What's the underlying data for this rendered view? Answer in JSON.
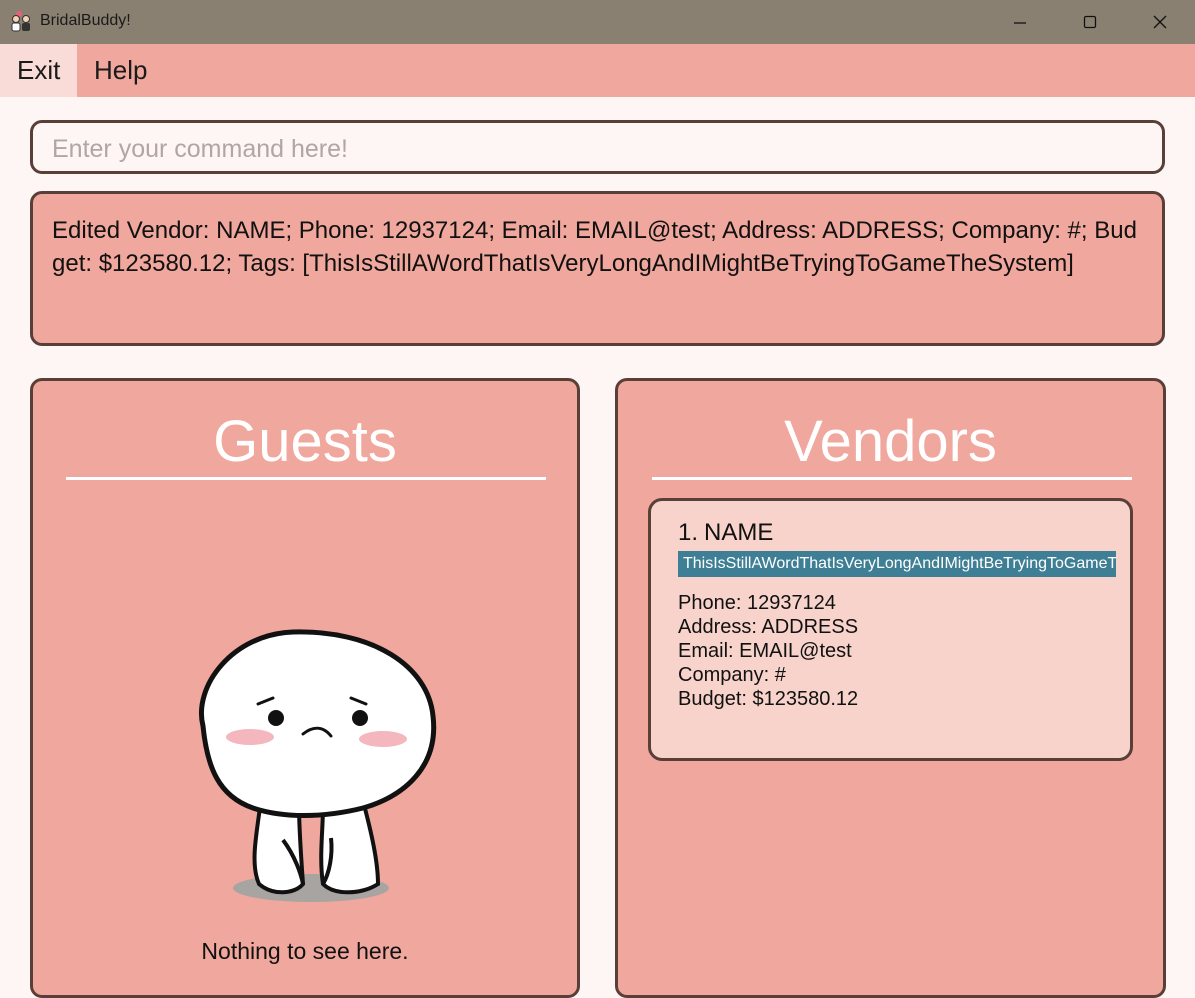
{
  "window": {
    "title": "BridalBuddy!",
    "app_icon": "couple-icon",
    "controls": [
      "minimize-icon",
      "maximize-icon",
      "close-icon"
    ]
  },
  "menu": {
    "exit_label": "Exit",
    "help_label": "Help"
  },
  "command": {
    "placeholder": "Enter your command here!",
    "value": ""
  },
  "result": {
    "text": "Edited Vendor: NAME; Phone: 12937124; Email: EMAIL@test; Address: ADDRESS; Company: #; Budget: $123580.12; Tags: [ThisIsStillAWordThatIsVeryLongAndIMightBeTryingToGameTheSystem]"
  },
  "guests": {
    "title": "Guests",
    "empty_text": "Nothing to see here.",
    "empty_icon": "sad-mascot-icon"
  },
  "vendors": {
    "title": "Vendors",
    "items": [
      {
        "index": "1.",
        "name": "NAME",
        "tag": "ThisIsStillAWordThatIsVeryLongAndIMightBeTryingToGameTheSystem",
        "phone": "Phone: 12937124",
        "address": "Address: ADDRESS",
        "email": "Email: EMAIL@test",
        "company": "Company: #",
        "budget": "Budget: $123580.12"
      }
    ]
  },
  "colors": {
    "titlebar": "#8a8072",
    "menubar": "#f0a79d",
    "menu_active": "#f9dcd7",
    "panel": "#f0a79d",
    "border": "#5a3f38",
    "card": "#f7d3cb",
    "tag": "#3f7f95",
    "background": "#fdf6f5"
  }
}
